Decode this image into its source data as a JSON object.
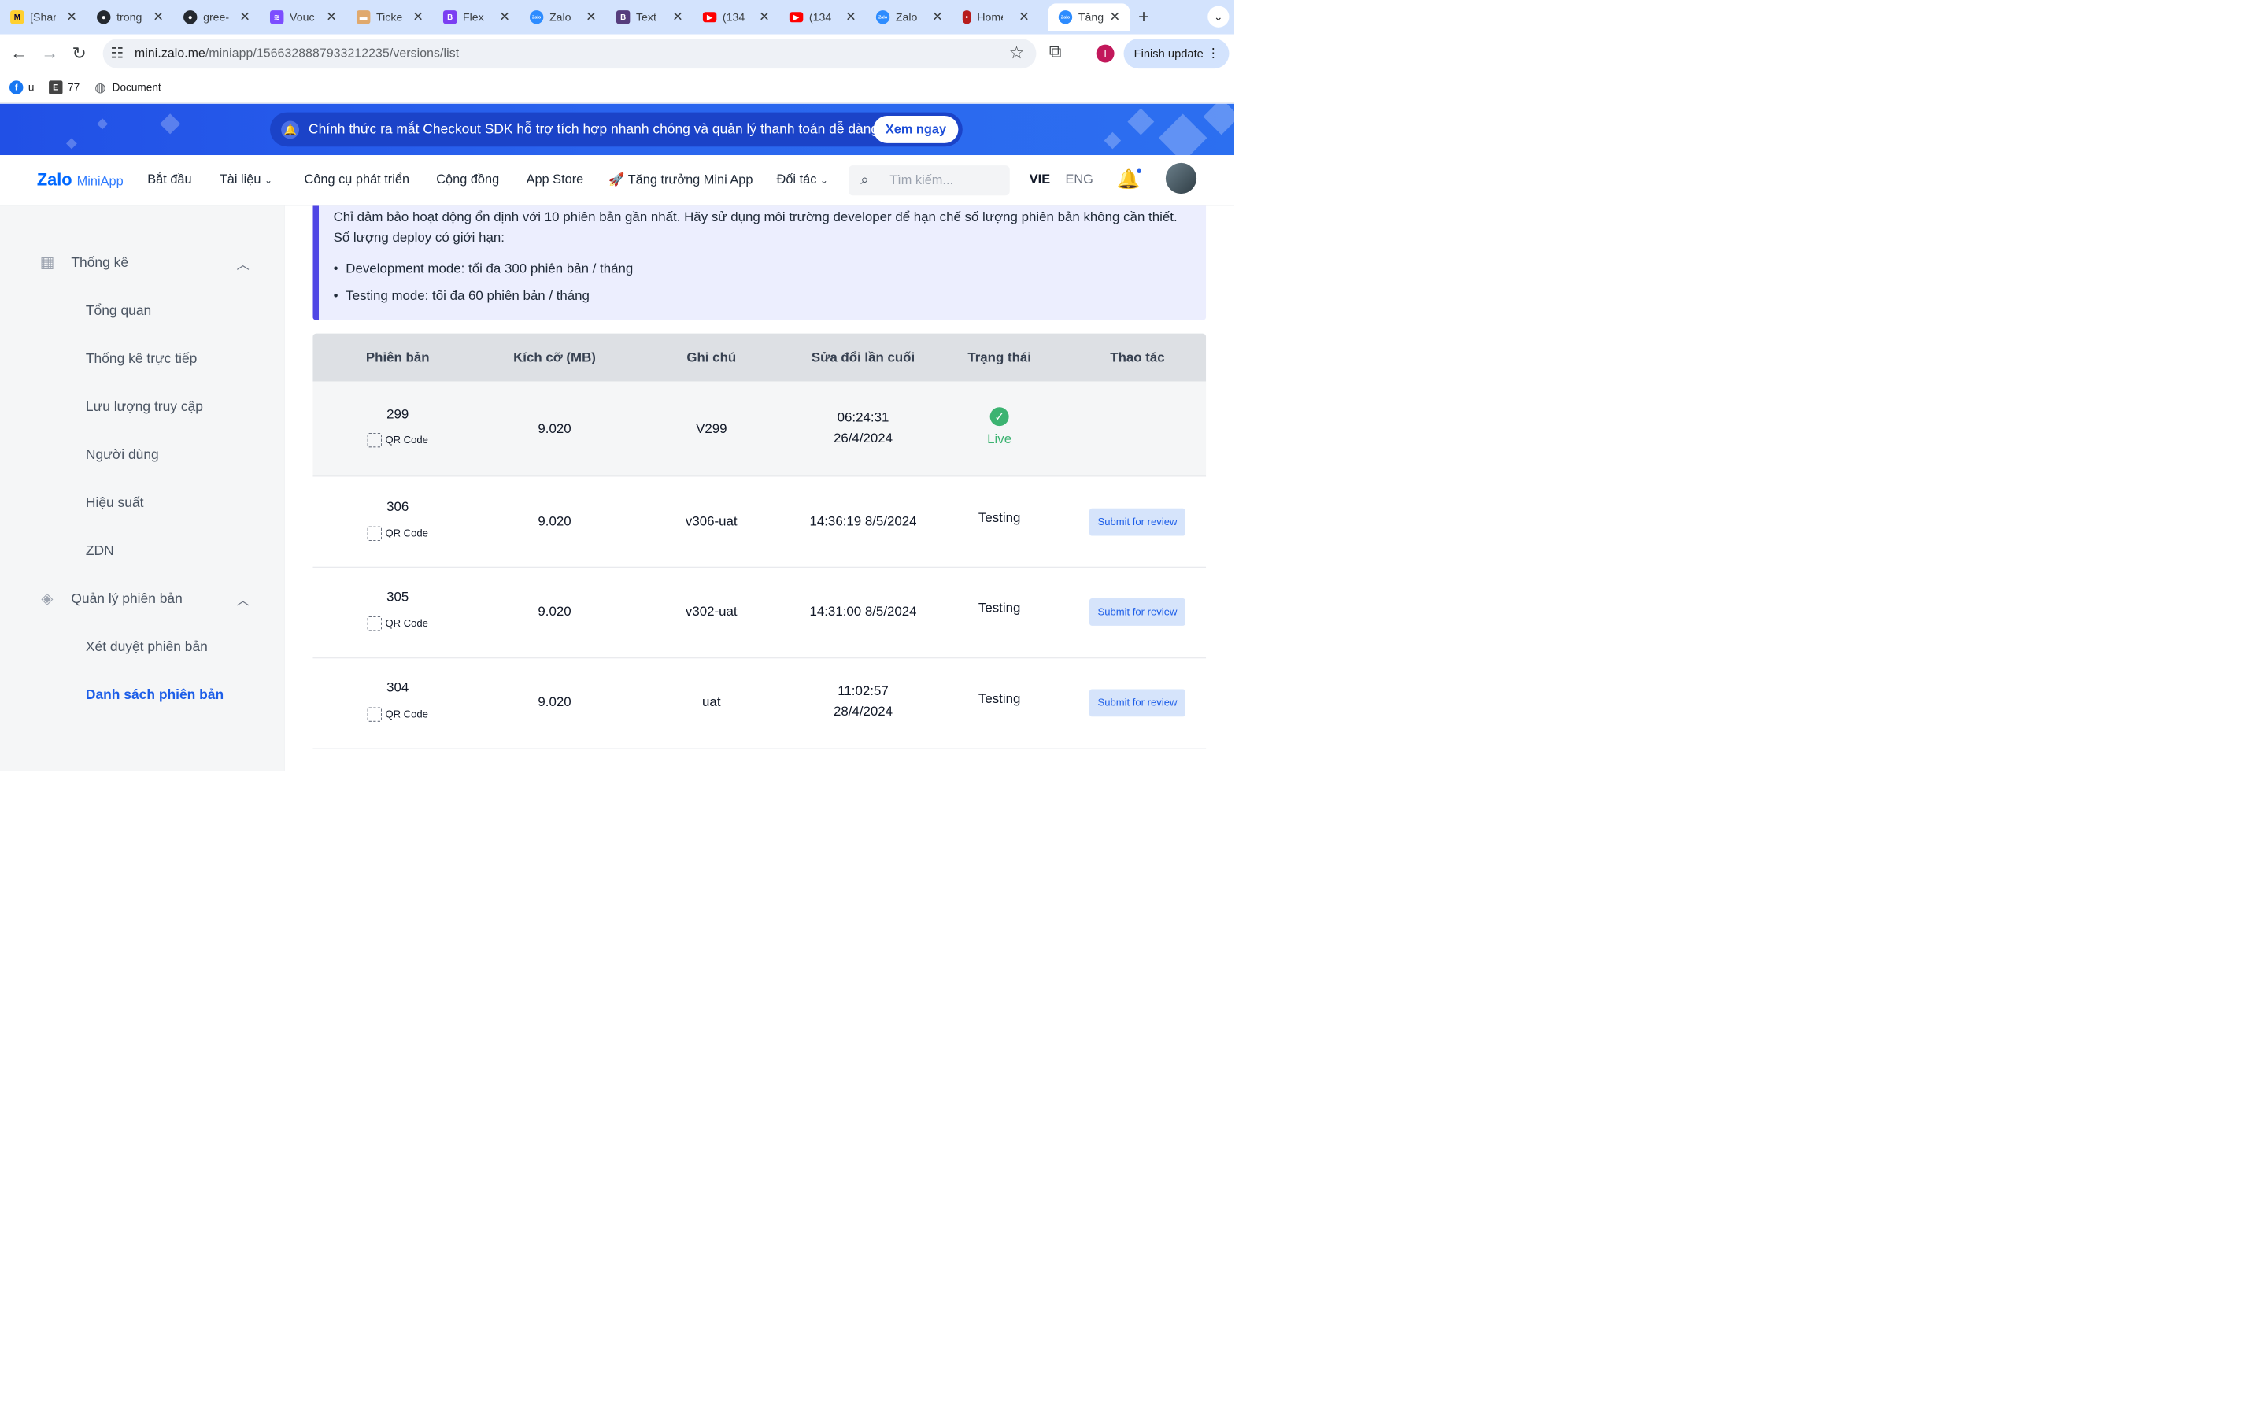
{
  "browser": {
    "tabs": [
      {
        "title": "[Shar",
        "icon": "miro-icon",
        "color": "#ffd02f"
      },
      {
        "title": "trong",
        "icon": "github-icon",
        "color": "#24292f"
      },
      {
        "title": "gree-",
        "icon": "github-icon",
        "color": "#24292f"
      },
      {
        "title": "Vouc",
        "icon": "layers-icon",
        "color": "#7c4dff"
      },
      {
        "title": "Ticke",
        "icon": "ticket-icon",
        "color": "#e0a96d"
      },
      {
        "title": "Flex",
        "icon": "bootstrap-icon",
        "color": "#7b3ff2"
      },
      {
        "title": "Zalo",
        "icon": "zalo-icon",
        "color": "#2d8cff"
      },
      {
        "title": "Text",
        "icon": "bootstrap-icon",
        "color": "#563d7c"
      },
      {
        "title": "(134",
        "icon": "youtube-icon",
        "color": "#ff0000"
      },
      {
        "title": "(134",
        "icon": "youtube-icon",
        "color": "#ff0000"
      },
      {
        "title": "Zalo",
        "icon": "zalo-icon",
        "color": "#2d8cff"
      },
      {
        "title": "Home",
        "icon": "home-app-icon",
        "color": "#b71c1c"
      },
      {
        "title": "Tăng",
        "icon": "zalo-icon",
        "color": "#2d8cff",
        "active": true
      }
    ],
    "url_host": "mini.zalo.me",
    "url_path": "/miniapp/1566328887933212235/versions/list",
    "profile_initial": "T",
    "finish_update_label": "Finish update",
    "bookmarks": [
      {
        "label": "u",
        "icon": "facebook-icon"
      },
      {
        "label": "77",
        "icon": "e-icon"
      },
      {
        "label": "Document",
        "icon": "globe-icon"
      }
    ]
  },
  "banner": {
    "message": "Chính thức ra mắt Checkout SDK hỗ trợ tích hợp nhanh chóng và quản lý thanh toán dễ dàng",
    "cta": "Xem ngay"
  },
  "header": {
    "logo_main": "Zalo",
    "logo_sub": "MiniApp",
    "nav": [
      "Bắt đầu",
      "Tài liệu",
      "Công cụ phát triển",
      "Cộng đồng",
      "App Store",
      "🚀 Tăng trưởng Mini App",
      "Đối tác"
    ],
    "search_placeholder": "Tìm kiếm...",
    "lang_vi": "VIE",
    "lang_en": "ENG"
  },
  "sidebar": {
    "groups": [
      {
        "label": "Thống kê",
        "items": [
          "Tổng quan",
          "Thống kê trực tiếp",
          "Lưu lượng truy cập",
          "Người dùng",
          "Hiệu suất",
          "ZDN"
        ]
      },
      {
        "label": "Quản lý phiên bản",
        "items": [
          "Xét duyệt phiên bản",
          "Danh sách phiên bản"
        ]
      }
    ],
    "active_item": "Danh sách phiên bản"
  },
  "notice": {
    "line1": "Chỉ đảm bảo hoạt động ổn định với 10 phiên bản gần nhất. Hãy sử dụng môi trường developer để hạn chế số lượng phiên bản không cần thiết.",
    "line2": "Số lượng deploy có giới hạn:",
    "bullets": [
      "Development mode: tối đa 300 phiên bản / tháng",
      "Testing mode: tối đa 60 phiên bản / tháng"
    ]
  },
  "table": {
    "headers": [
      "Phiên bản",
      "Kích cỡ (MB)",
      "Ghi chú",
      "Sửa đổi lần cuối",
      "Trạng thái",
      "Thao tác"
    ],
    "qr_label": "QR Code",
    "submit_label": "Submit for review",
    "rows": [
      {
        "version": "299",
        "size": "9.020",
        "note": "V299",
        "modified_1": "06:24:31",
        "modified_2": "26/4/2024",
        "status": "Live",
        "status_color": "#3cb371"
      },
      {
        "version": "306",
        "size": "9.020",
        "note": "v306-uat",
        "modified_1": "14:36:19 8/5/2024",
        "modified_2": "",
        "status": "Testing",
        "status_color": "#111827"
      },
      {
        "version": "305",
        "size": "9.020",
        "note": "v302-uat",
        "modified_1": "14:31:00 8/5/2024",
        "modified_2": "",
        "status": "Testing",
        "status_color": "#111827"
      },
      {
        "version": "304",
        "size": "9.020",
        "note": "uat",
        "modified_1": "11:02:57",
        "modified_2": "28/4/2024",
        "status": "Testing",
        "status_color": "#111827"
      }
    ]
  }
}
